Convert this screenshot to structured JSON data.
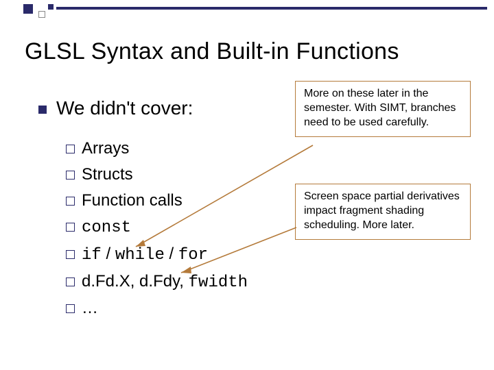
{
  "title": "GLSL Syntax and Built-in Functions",
  "heading": "We didn't cover:",
  "items": {
    "arrays": "Arrays",
    "structs": "Structs",
    "fcalls": "Function calls",
    "const": "const",
    "if": "if",
    "while": "while",
    "for": "for",
    "sep": " / ",
    "dfdx": "d.Fd.X",
    "comma": ", ",
    "dfdy": "d.Fdy",
    "fwidth": "fwidth",
    "ellipsis": "…"
  },
  "callouts": {
    "simt": "More on these later in the semester.  With SIMT, branches need to be used carefully.",
    "deriv": "Screen space partial derivatives impact fragment shading scheduling. More later."
  }
}
